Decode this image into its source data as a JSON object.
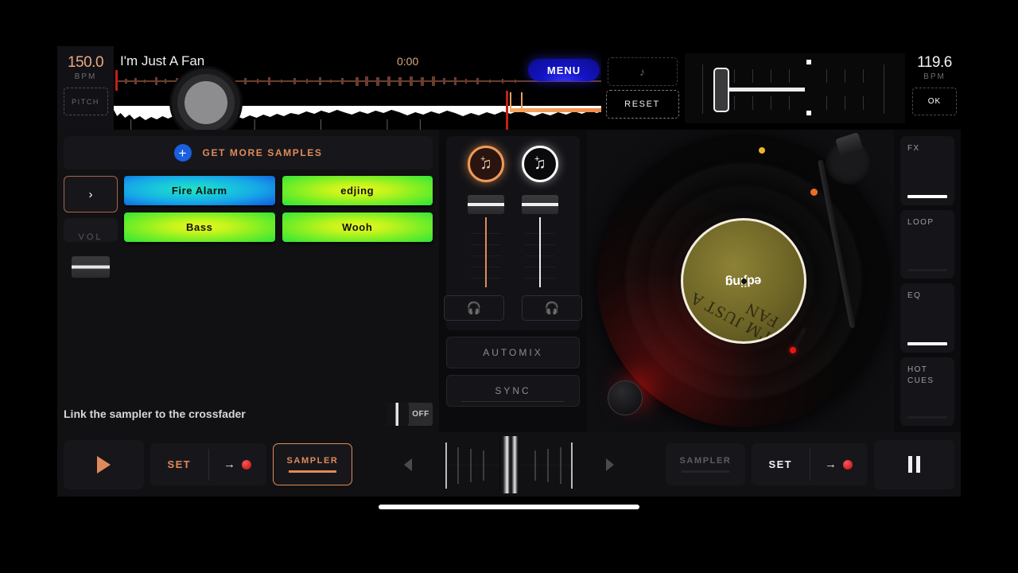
{
  "deck_left": {
    "bpm_value": "150.0",
    "bpm_label": "BPM",
    "pitch_label": "PITCH",
    "track_title": "I'm Just A Fan",
    "time": "0:00"
  },
  "menu": {
    "label": "MENU"
  },
  "pitch_panel": {
    "note_icon": "music-note-icon",
    "reset_label": "RESET"
  },
  "deck_right": {
    "bpm_value": "119.6",
    "bpm_label": "BPM",
    "ok_label": "OK"
  },
  "sampler": {
    "get_more_label": "GET MORE SAMPLES",
    "plus_icon": "+",
    "next_icon": "›",
    "vol_label": "VOL",
    "pads": [
      {
        "label": "Fire Alarm",
        "color_class": "blue",
        "color": "#19cbd8"
      },
      {
        "label": "edjing",
        "color_class": "green",
        "color": "#7aee25"
      },
      {
        "label": "Bass",
        "color_class": "green",
        "color": "#7aee25"
      },
      {
        "label": "Wooh",
        "color_class": "green",
        "color": "#7aee25"
      }
    ],
    "link_text": "Link the sampler to the crossfader",
    "toggle_state": "OFF"
  },
  "mixer": {
    "load_left_icon": "add-music-note-icon",
    "load_right_icon": "add-music-note-icon",
    "cue_left_icon": "headphones-icon",
    "cue_right_icon": "headphones-icon",
    "automix_label": "AUTOMIX",
    "sync_label": "SYNC"
  },
  "deck_visual": {
    "plus_label": "+",
    "minus_label": "−",
    "record_brand": "edjing",
    "record_handwriting": "I'M JUST A FAN"
  },
  "rail": {
    "items": [
      {
        "label": "FX",
        "bar": "bright"
      },
      {
        "label": "LOOP",
        "bar": "dim"
      },
      {
        "label": "EQ",
        "bar": "bright"
      },
      {
        "label": "HOT\nCUES",
        "bar": "dim"
      }
    ],
    "fx_label": "FX",
    "loop_label": "LOOP",
    "eq_label": "EQ",
    "hotcues_label": "HOT CUES"
  },
  "transport": {
    "play_icon": "play-icon",
    "left_set_label": "SET",
    "left_arrow_icon": "→",
    "left_sampler_label": "SAMPLER",
    "right_sampler_label": "SAMPLER",
    "right_set_label": "SET",
    "right_arrow_icon": "→",
    "pause_icon": "pause-icon"
  },
  "colors": {
    "accent_orange": "#e08a5a",
    "menu_blue": "#1414c8",
    "playhead_red": "#c0201a",
    "rec_red": "#b80f0f"
  }
}
